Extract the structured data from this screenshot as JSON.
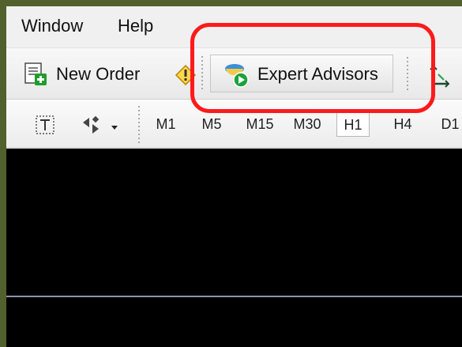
{
  "menu": {
    "window": "Window",
    "help": "Help"
  },
  "toolbar": {
    "new_order": "New Order",
    "expert_advisors": "Expert Advisors"
  },
  "timeframes": [
    "M1",
    "M5",
    "M15",
    "M30",
    "H1",
    "H4",
    "D1"
  ],
  "active_timeframe": "H1",
  "icons": {
    "new_order": "new-order-icon",
    "warning": "warning-icon",
    "expert_advisors": "expert-advisors-icon",
    "crosshair": "crosshair-icon",
    "text": "text-icon",
    "arrows": "arrows-icon"
  },
  "colors": {
    "highlight": "#ff1a1a",
    "chart_background": "#000000",
    "toolbar_background": "#f0f0f0"
  }
}
